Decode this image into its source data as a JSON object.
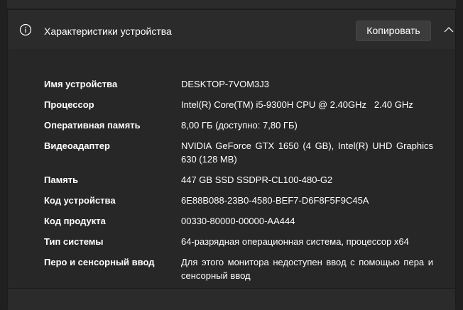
{
  "header": {
    "icon": "info-icon",
    "title": "Характеристики устройства",
    "copy_label": "Копировать",
    "collapse_icon": "chevron-up-icon"
  },
  "specs": [
    {
      "label": "Имя устройства",
      "value": "DESKTOP-7VOM3J3"
    },
    {
      "label": "Процессор",
      "value": "Intel(R) Core(TM) i5-9300H CPU @ 2.40GHz   2.40 GHz"
    },
    {
      "label": "Оперативная память",
      "value": "8,00 ГБ (доступно: 7,80 ГБ)"
    },
    {
      "label": "Видеоадаптер",
      "value": "NVIDIA GeForce GTX 1650 (4 GB), Intel(R) UHD Graphics 630 (128 MB)"
    },
    {
      "label": "Память",
      "value": "447 GB SSD SSDPR-CL100-480-G2"
    },
    {
      "label": "Код устройства",
      "value": "6E88B088-23B0-4580-BEF7-D6F8F5F9C45A"
    },
    {
      "label": "Код продукта",
      "value": "00330-80000-00000-AA444"
    },
    {
      "label": "Тип системы",
      "value": "64-разрядная операционная система, процессор x64"
    },
    {
      "label": "Перо и сенсорный ввод",
      "value": "Для этого монитора недоступен ввод с помощью пера и сенсорный ввод"
    }
  ],
  "colors": {
    "background": "#202020",
    "panel": "#272727",
    "header": "#2b2b2b",
    "button": "#3c3c3c",
    "text": "#ffffff"
  }
}
